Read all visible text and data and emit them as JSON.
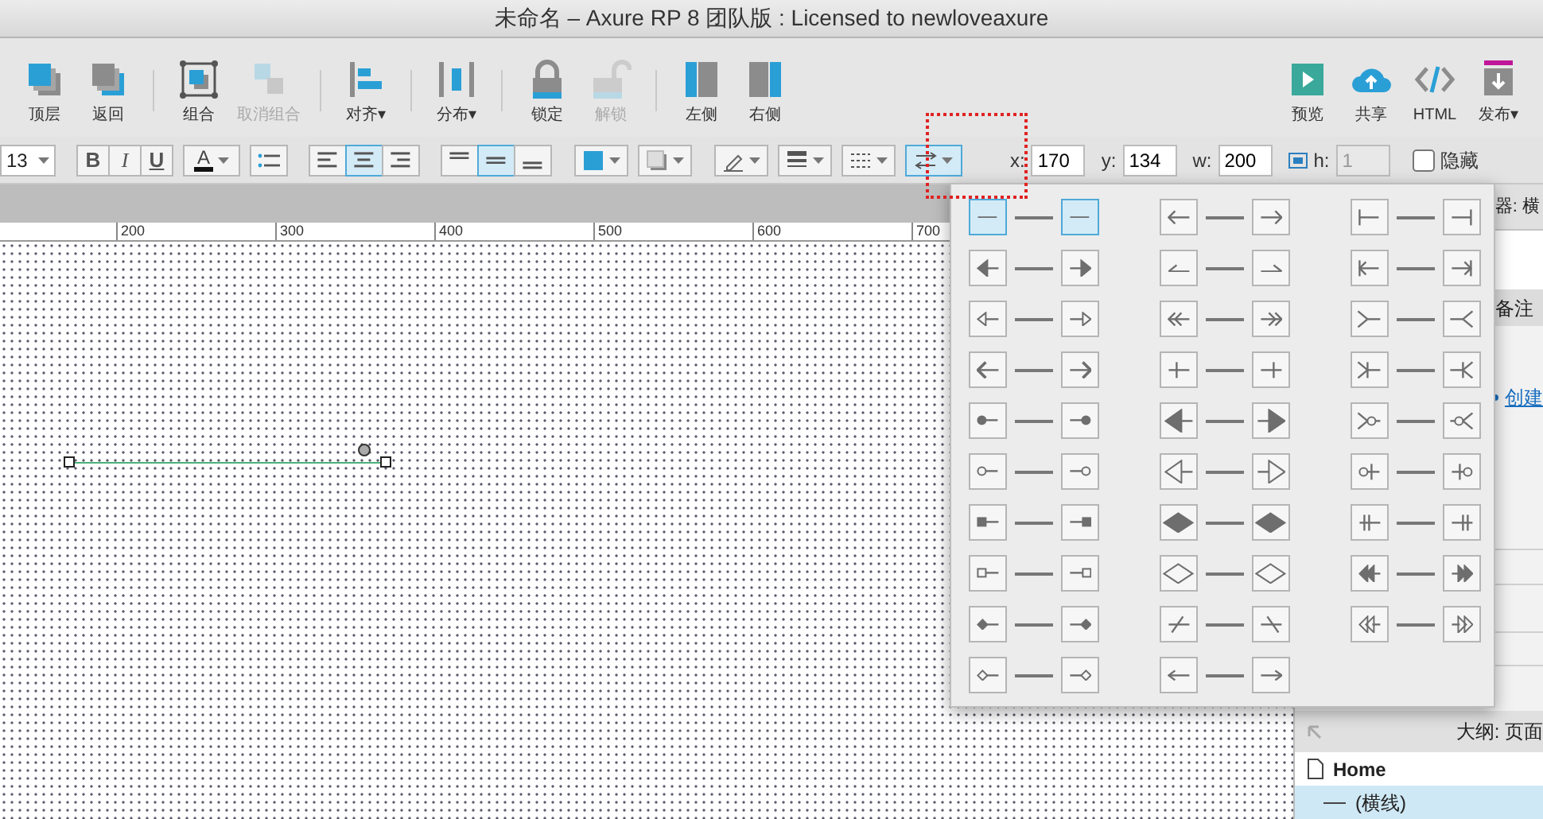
{
  "window": {
    "title": "未命名 – Axure RP 8 团队版 : Licensed to newloveaxure"
  },
  "toolbar": {
    "left_groups": [
      [
        {
          "kind": "bring-front",
          "label": "顶层",
          "disabled": false
        },
        {
          "kind": "send-back",
          "label": "返回",
          "disabled": false
        }
      ],
      [
        {
          "kind": "group",
          "label": "组合",
          "disabled": false
        },
        {
          "kind": "ungroup",
          "label": "取消组合",
          "disabled": true
        }
      ],
      [
        {
          "kind": "align",
          "label": "对齐▾",
          "disabled": false
        }
      ],
      [
        {
          "kind": "distribute",
          "label": "分布▾",
          "disabled": false
        }
      ],
      [
        {
          "kind": "lock",
          "label": "锁定",
          "disabled": false
        },
        {
          "kind": "unlock",
          "label": "解锁",
          "disabled": true
        }
      ],
      [
        {
          "kind": "left-panel",
          "label": "左侧",
          "disabled": false
        },
        {
          "kind": "right-panel",
          "label": "右侧",
          "disabled": false
        }
      ]
    ],
    "right_items": [
      {
        "kind": "preview",
        "label": "预览"
      },
      {
        "kind": "share",
        "label": "共享"
      },
      {
        "kind": "html",
        "label": "HTML"
      },
      {
        "kind": "publish",
        "label": "发布▾"
      }
    ]
  },
  "format_bar": {
    "font_size": "13",
    "text_styles": [
      {
        "kind": "bold",
        "label": "B"
      },
      {
        "kind": "italic",
        "label": "I"
      },
      {
        "kind": "underline",
        "label": "U"
      }
    ],
    "font_color": {
      "label": "A"
    },
    "align": [
      {
        "kind": "left",
        "selected": false
      },
      {
        "kind": "center",
        "selected": true
      },
      {
        "kind": "right",
        "selected": false
      }
    ],
    "valign": [
      {
        "kind": "top",
        "selected": false
      },
      {
        "kind": "middle",
        "selected": true
      },
      {
        "kind": "bottom",
        "selected": false
      }
    ],
    "arrow_menu_open": true,
    "fields": [
      {
        "kind": "x",
        "label": "x:",
        "value": "170",
        "disabled": false
      },
      {
        "kind": "y",
        "label": "y:",
        "value": "134",
        "disabled": false
      },
      {
        "kind": "w",
        "label": "w:",
        "value": "200",
        "disabled": false
      },
      {
        "kind": "h",
        "label": "h:",
        "value": "1",
        "disabled": true
      }
    ],
    "hidden": {
      "label": "隐藏",
      "checked": false
    }
  },
  "ruler": {
    "labels": [
      "200",
      "300",
      "400",
      "500",
      "600",
      "700"
    ]
  },
  "arrow_styles": [
    {
      "kind": "none",
      "selected": true
    },
    {
      "kind": "open-arrow",
      "selected": false
    },
    {
      "kind": "bar",
      "selected": false
    },
    {
      "kind": "filled-arrow",
      "selected": false
    },
    {
      "kind": "half-arrow",
      "selected": false
    },
    {
      "kind": "bar-arrow",
      "selected": false
    },
    {
      "kind": "small-open-triangle",
      "selected": false
    },
    {
      "kind": "double-chevron",
      "selected": false
    },
    {
      "kind": "crow-foot",
      "selected": false
    },
    {
      "kind": "chevron",
      "selected": false
    },
    {
      "kind": "cross",
      "selected": false
    },
    {
      "kind": "bar-crow-foot",
      "selected": false
    },
    {
      "kind": "filled-dot",
      "selected": false
    },
    {
      "kind": "large-filled-triangle",
      "selected": false
    },
    {
      "kind": "circle-crow-foot",
      "selected": false
    },
    {
      "kind": "hollow-dot",
      "selected": false
    },
    {
      "kind": "large-hollow-triangle",
      "selected": false
    },
    {
      "kind": "circle-bar",
      "selected": false
    },
    {
      "kind": "filled-square",
      "selected": false
    },
    {
      "kind": "filled-diamond",
      "selected": false
    },
    {
      "kind": "double-bar",
      "selected": false
    },
    {
      "kind": "hollow-square",
      "selected": false
    },
    {
      "kind": "hollow-diamond",
      "selected": false
    },
    {
      "kind": "double-filled-arrow",
      "selected": false
    },
    {
      "kind": "small-filled-diamond",
      "selected": false
    },
    {
      "kind": "slash",
      "selected": false
    },
    {
      "kind": "double-hollow-arrow",
      "selected": false
    },
    {
      "kind": "small-hollow-diamond",
      "selected": false
    },
    {
      "kind": "thin-arrow",
      "selected": false
    }
  ],
  "inspector": {
    "title": "器: 横",
    "notes_tab": "备注",
    "create_link": "创建"
  },
  "outline": {
    "title": "大纲: 页面",
    "tree": [
      {
        "label": "Home",
        "selected": false,
        "children": [
          {
            "label": "(横线)",
            "selected": true
          }
        ]
      }
    ]
  }
}
